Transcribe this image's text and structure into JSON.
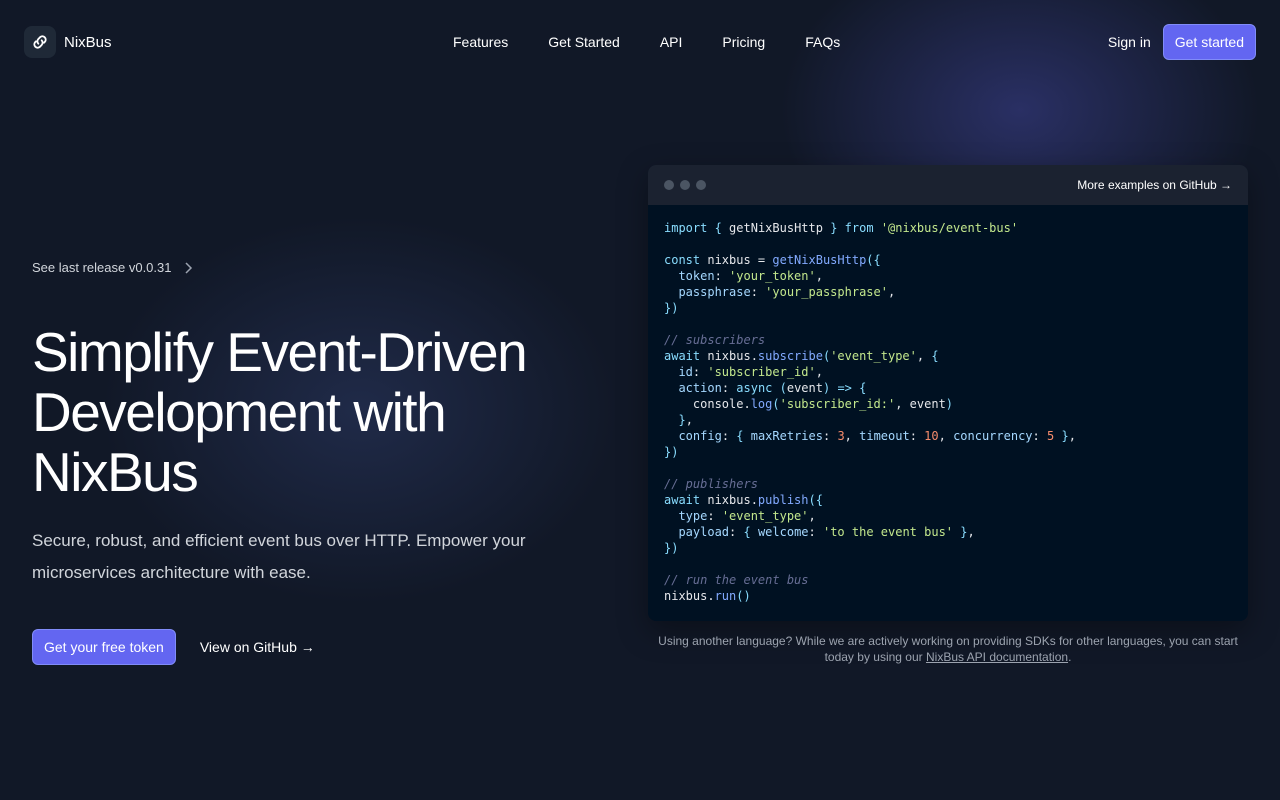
{
  "brand": {
    "name": "NixBus",
    "logo_icon": "link-icon"
  },
  "nav": {
    "items": [
      "Features",
      "Get Started",
      "API",
      "Pricing",
      "FAQs"
    ]
  },
  "header": {
    "signin_label": "Sign in",
    "get_started_label": "Get started"
  },
  "hero": {
    "release_label": "See last release v0.0.31",
    "title_lines": [
      "Simplify Event-Driven",
      "Development with",
      "NixBus"
    ],
    "subtitle": "Secure, robust, and efficient event bus over HTTP. Empower your microservices architecture with ease.",
    "primary_cta": "Get your free token",
    "secondary_cta": "View on GitHub →"
  },
  "code_panel": {
    "more_examples_label": "More examples on GitHub →",
    "lines": [
      "import { getNixBusHttp } from '@nixbus/event-bus'",
      "",
      "const nixbus = getNixBusHttp({",
      "  token: 'your_token',",
      "  passphrase: 'your_passphrase',",
      "})",
      "",
      "// subscribers",
      "await nixbus.subscribe('event_type', {",
      "  id: 'subscriber_id',",
      "  action: async (event) => {",
      "    console.log('subscriber_id:', event)",
      "  },",
      "  config: { maxRetries: 3, timeout: 10, concurrency: 5 },",
      "})",
      "",
      "// publishers",
      "await nixbus.publish({",
      "  type: 'event_type',",
      "  payload: { welcome: 'to the event bus' },",
      "})",
      "",
      "// run the event bus",
      "nixbus.run()"
    ]
  },
  "note": {
    "text_before": "Using another language? While we are actively working on providing SDKs for other languages, you can start today by using our ",
    "link_label": "NixBus API documentation",
    "text_after": "."
  },
  "colors": {
    "accent": "#6366f1",
    "background": "#111827",
    "code_background": "#001122"
  }
}
